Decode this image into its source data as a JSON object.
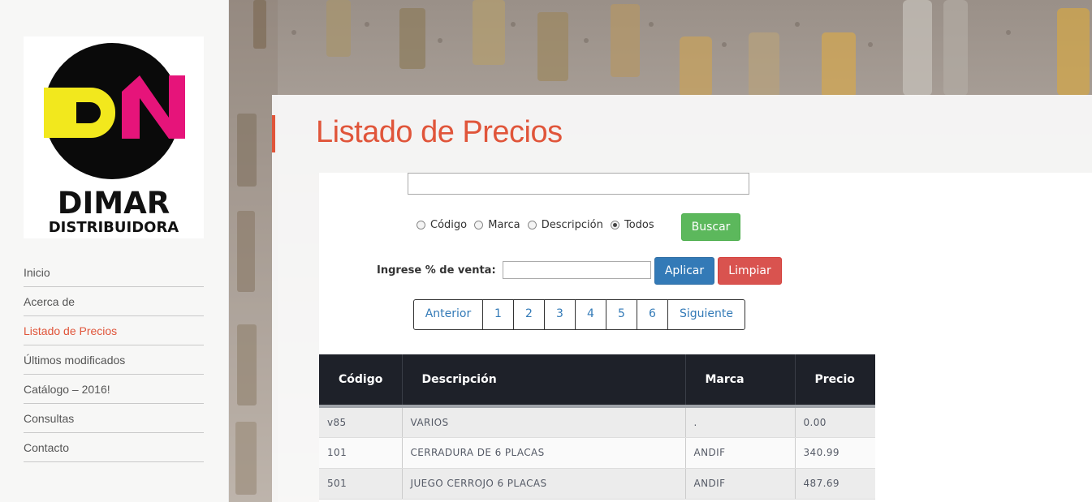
{
  "logo": {
    "line1": "DIMAR",
    "line2": "DISTRIBUIDORA",
    "colors": {
      "yellow": "#f2e81d",
      "magenta": "#e6147a",
      "black": "#0a0a0a"
    }
  },
  "nav": {
    "items": [
      {
        "label": "Inicio"
      },
      {
        "label": "Acerca de"
      },
      {
        "label": "Listado de Precios"
      },
      {
        "label": "Últimos modificados"
      },
      {
        "label": "Catálogo – 2016!"
      },
      {
        "label": "Consultas"
      },
      {
        "label": "Contacto"
      }
    ],
    "active_index": 2
  },
  "page": {
    "title": "Listado de Precios",
    "accent_color": "#e0553a"
  },
  "search": {
    "value": "",
    "radios": [
      {
        "label": "Código",
        "checked": false
      },
      {
        "label": "Marca",
        "checked": false
      },
      {
        "label": "Descripción",
        "checked": false
      },
      {
        "label": "Todos",
        "checked": true
      }
    ],
    "button": "Buscar"
  },
  "percent": {
    "label": "Ingrese % de venta:",
    "value": "",
    "apply": "Aplicar",
    "clear": "Limpiar"
  },
  "pagination": {
    "prev": "Anterior",
    "pages": [
      "1",
      "2",
      "3",
      "4",
      "5",
      "6"
    ],
    "next": "Siguiente"
  },
  "table": {
    "headers": [
      "Código",
      "Descripción",
      "Marca",
      "Precio"
    ],
    "rows": [
      [
        "v85",
        "VARIOS",
        ".",
        "0.00"
      ],
      [
        "101",
        "CERRADURA DE 6 PLACAS",
        "ANDIF",
        "340.99"
      ],
      [
        "501",
        "JUEGO CERROJO 6 PLACAS",
        "ANDIF",
        "487.69"
      ]
    ]
  }
}
